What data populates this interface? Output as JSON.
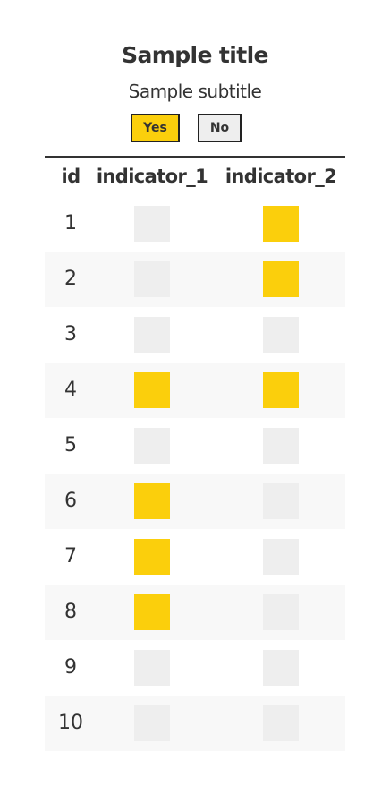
{
  "colors": {
    "yes": "#fbcf0c",
    "no": "#eeeeee",
    "row_alt": "#f8f8f8",
    "text": "#333333"
  },
  "chart_data": {
    "type": "table",
    "title": "Sample title",
    "subtitle": "Sample subtitle",
    "legend": {
      "placement": "top-center",
      "entries": [
        {
          "label": "Yes",
          "color": "#fbcf0c"
        },
        {
          "label": "No",
          "color": "#eeeeee"
        }
      ]
    },
    "columns": [
      "id",
      "indicator_1",
      "indicator_2"
    ],
    "rows": [
      {
        "id": "1",
        "indicator_1": "No",
        "indicator_2": "Yes"
      },
      {
        "id": "2",
        "indicator_1": "No",
        "indicator_2": "Yes"
      },
      {
        "id": "3",
        "indicator_1": "No",
        "indicator_2": "No"
      },
      {
        "id": "4",
        "indicator_1": "Yes",
        "indicator_2": "Yes"
      },
      {
        "id": "5",
        "indicator_1": "No",
        "indicator_2": "No"
      },
      {
        "id": "6",
        "indicator_1": "Yes",
        "indicator_2": "No"
      },
      {
        "id": "7",
        "indicator_1": "Yes",
        "indicator_2": "No"
      },
      {
        "id": "8",
        "indicator_1": "Yes",
        "indicator_2": "No"
      },
      {
        "id": "9",
        "indicator_1": "No",
        "indicator_2": "No"
      },
      {
        "id": "10",
        "indicator_1": "No",
        "indicator_2": "No"
      }
    ]
  }
}
